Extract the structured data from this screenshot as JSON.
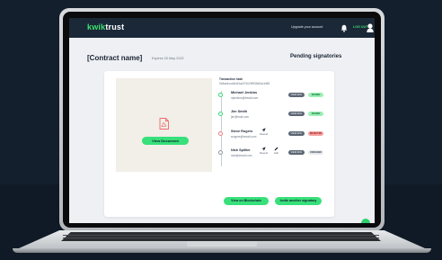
{
  "app": {
    "logo_prefix": "kwik",
    "logo_suffix": "trust"
  },
  "nav": {
    "upgrade_label": "Upgrade your account",
    "logout_label": "LOG OUT"
  },
  "page": {
    "title": "[Contract name]",
    "expires": "Expires 20 May 2022",
    "section_title": "Pending signatories"
  },
  "document": {
    "view_label": "View Document"
  },
  "transaction": {
    "label": "Transaction hash",
    "hash": "0x8ae4ccc8e4f1ab7f1b2f9938b2a1e5f8"
  },
  "signatories": [
    {
      "name": "Michael Jenkins",
      "email": "mjenkins@email.com",
      "action_label": "VIEW DOC",
      "status": "SIGNED",
      "status_type": "signed"
    },
    {
      "name": "Jim Smith",
      "email": "jim@mail.com",
      "action_label": "VIEW DOC",
      "status": "SIGNED",
      "status_type": "signed"
    },
    {
      "name": "Steve Rogers",
      "email": "srogers@email.com",
      "resend_label": "Resend",
      "action_label": "VIEW DOC",
      "status": "REJECTED",
      "status_type": "rejected"
    },
    {
      "name": "Nick Spillier",
      "email": "nick@email.com",
      "resend_label": "Resend",
      "edit_label": "Edit",
      "action_label": "VIEW DOC",
      "status": "UNSIGNED",
      "status_type": "unsigned"
    }
  ],
  "actions": {
    "blockchain_label": "View on Blockchain",
    "invite_label": "Invite another signatory"
  },
  "colors": {
    "brand_green": "#37e07a",
    "nav_bg": "#1a2838",
    "rejected": "#f7a0a0"
  }
}
